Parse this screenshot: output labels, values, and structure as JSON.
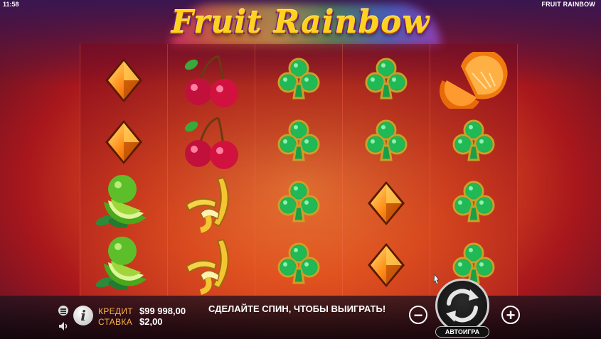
{
  "status_bar": {
    "time": "11:58",
    "game_name": "FRUIT RAINBOW"
  },
  "logo": {
    "text": "Fruit Rainbow"
  },
  "reels": [
    [
      "diamond",
      "diamond",
      "lime",
      "lime"
    ],
    [
      "cherries",
      "cherries",
      "banana",
      "banana"
    ],
    [
      "club",
      "club",
      "club",
      "club"
    ],
    [
      "club",
      "club",
      "diamond",
      "diamond"
    ],
    [
      "orange",
      "club",
      "club",
      "club"
    ]
  ],
  "hud": {
    "credit_label": "КРЕДИТ",
    "credit_value": "$99 998,00",
    "bet_label": "СТАВКА",
    "bet_value": "$2,00",
    "message": "СДЕЛАЙТЕ СПИН, ЧТОБЫ ВЫИГРАТЬ!",
    "minus_label": "−",
    "plus_label": "+",
    "autoplay_label": "АВТОИГРА",
    "info_label": "i"
  },
  "icons": {
    "menu": "menu-icon",
    "sound": "speaker-icon",
    "info": "info-icon",
    "spin": "spin-arrows-icon"
  },
  "colors": {
    "label_orange": "#ffb347",
    "club_green": "#1fa84a",
    "diamond_orange": "#ff8a1a",
    "cherry_red": "#d1123f"
  }
}
